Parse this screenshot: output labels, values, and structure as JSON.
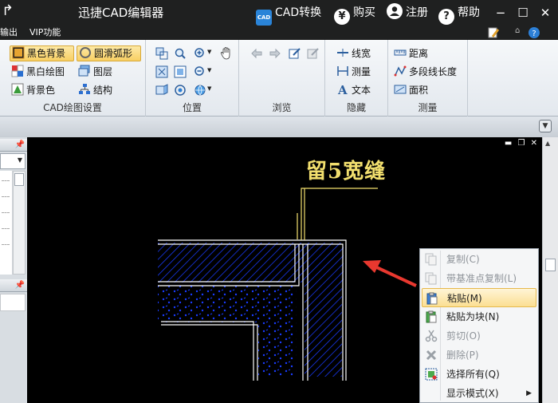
{
  "titlebar": {
    "back_glyph": "↱",
    "app_title": "迅捷CAD编辑器",
    "cad_logo": "CAD",
    "cad_convert": "CAD转换",
    "buy_glyph": "¥",
    "buy": "购买",
    "register": "注册",
    "help_glyph": "?",
    "help": "帮助",
    "minimize": "−",
    "maximize": "☐",
    "close": "✕"
  },
  "menubar": {
    "output": "输出",
    "vip": "VIP功能"
  },
  "ribbon": {
    "groups": {
      "cad_draw": {
        "label": "CAD绘图设置",
        "black_bg": "黑色背景",
        "smooth_arc": "圆滑弧形",
        "bw_draw": "黑白绘图",
        "layers": "图层",
        "bg_color": "背景色",
        "structure": "结构"
      },
      "position": {
        "label": "位置"
      },
      "browse": {
        "label": "浏览"
      },
      "hide": {
        "label": "隐藏",
        "linewidth": "线宽",
        "measure": "测量",
        "text": "文本"
      },
      "measure": {
        "label": "测量",
        "distance": "距离",
        "polyline_length": "多段线长度",
        "area": "面积"
      }
    }
  },
  "drawing": {
    "annotation": "留5宽缝",
    "annotation_color": "#f2df6e",
    "hatch_color": "#1a3cff",
    "arrow_color": "#e8382f"
  },
  "context_menu": {
    "items": [
      {
        "label": "复制(C)",
        "state": "disabled"
      },
      {
        "label": "带基准点复制(L)",
        "state": "disabled"
      },
      {
        "label": "粘贴(M)",
        "state": "highlighted"
      },
      {
        "label": "粘贴为块(N)",
        "state": "enabled"
      },
      {
        "label": "剪切(O)",
        "state": "disabled"
      },
      {
        "label": "删除(P)",
        "state": "disabled"
      },
      {
        "label": "选择所有(Q)",
        "state": "enabled"
      },
      {
        "label": "显示模式(X)",
        "state": "enabled"
      }
    ],
    "submenu_arrow": "▶"
  }
}
